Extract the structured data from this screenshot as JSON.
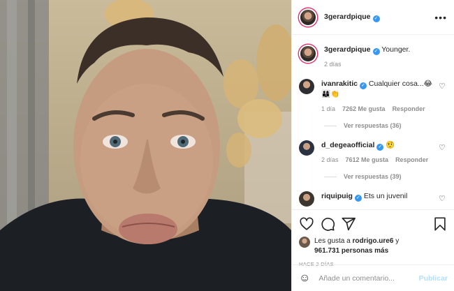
{
  "post": {
    "author": "3gerardpique",
    "more_icon": "more-horizontal-icon",
    "caption_author": "3gerardpique",
    "caption": "Younger.",
    "caption_age": "2 días"
  },
  "comments": [
    {
      "user": "ivanrakitic",
      "text": "Cualquier cosa...😂",
      "text2": "👨‍👩‍👦👏",
      "age": "1 día",
      "likes": "7262 Me gusta",
      "reply_label": "Responder",
      "view_replies": "Ver respuestas (36)"
    },
    {
      "user": "d_degeaofficial",
      "text": "🤨",
      "age": "2 días",
      "likes": "7612 Me gusta",
      "reply_label": "Responder",
      "view_replies": "Ver respuestas (39)"
    },
    {
      "user": "riquipuig",
      "text": "Ets un juvenil"
    }
  ],
  "likes": {
    "prefix": "Les gusta a",
    "user": "rodrigo.ure6",
    "joiner": "y",
    "count": "961.731 personas más"
  },
  "time_ago": "HACE 2 DÍAS",
  "composer": {
    "placeholder": "Añade un comentario...",
    "publish_label": "Publicar"
  },
  "colors": {
    "verified": "#3897f0",
    "publish_disabled": "#b2dffc",
    "muted_text": "#8e8e8e"
  }
}
